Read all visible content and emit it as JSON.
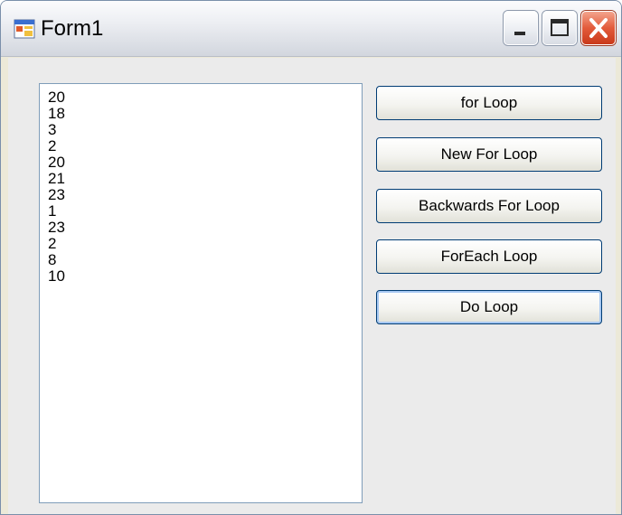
{
  "window": {
    "title": "Form1",
    "title_icon": "form-app-icon",
    "controls": [
      "minimize-icon",
      "maximize-icon",
      "close-icon"
    ],
    "close_color": "#e35b3b"
  },
  "listbox": {
    "items": [
      "20",
      "18",
      "3",
      "2",
      "20",
      "21",
      "23",
      "1",
      "23",
      "2",
      "8",
      "10"
    ]
  },
  "buttons": [
    {
      "label": "for Loop"
    },
    {
      "label": "New For Loop"
    },
    {
      "label": "Backwards For Loop"
    },
    {
      "label": "ForEach Loop"
    },
    {
      "label": "Do Loop",
      "focused": true
    }
  ]
}
